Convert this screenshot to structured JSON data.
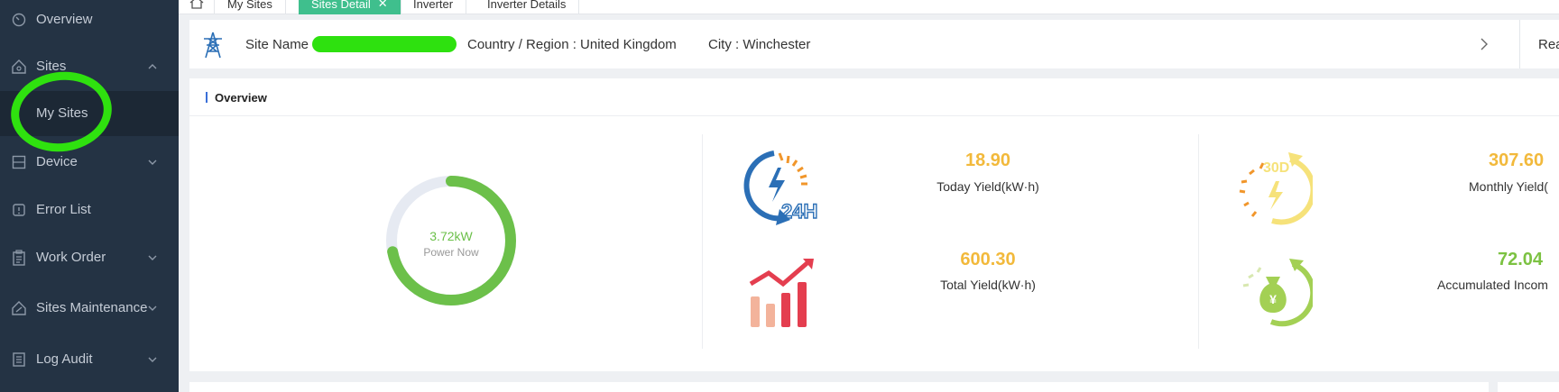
{
  "sidebar": {
    "items": [
      {
        "label": "Overview"
      },
      {
        "label": "Sites"
      },
      {
        "label": "My Sites"
      },
      {
        "label": "Device"
      },
      {
        "label": "Error List"
      },
      {
        "label": "Work Order"
      },
      {
        "label": "Sites Maintenance"
      },
      {
        "label": "Log Audit"
      }
    ]
  },
  "tabs": [
    {
      "label": "My Sites"
    },
    {
      "label": "Sites Detail"
    },
    {
      "label": "Inverter"
    },
    {
      "label": "Inverter Details"
    }
  ],
  "site": {
    "name_label": "Site Name",
    "country": "Country / Region : United Kingdom",
    "city": "City : Winchester",
    "right_label": "Rea"
  },
  "overview": {
    "title": "Overview",
    "power_now_value": "3.72kW",
    "power_now_label": "Power Now",
    "power_now_fraction": 0.72,
    "icon_24h_text": "24H",
    "icon_30d_text": "30D",
    "icon_currency": "¥",
    "stats": [
      {
        "value": "18.90",
        "label": "Today Yield(kW·h)",
        "color": "#f2b93b"
      },
      {
        "value": "307.60",
        "label": "Monthly Yield(",
        "color": "#f2b93b"
      },
      {
        "value": "600.30",
        "label": "Total Yield(kW·h)",
        "color": "#f2b93b"
      },
      {
        "value": "72.04",
        "label": "Accumulated Incom",
        "color": "#7cc242"
      }
    ]
  },
  "colors": {
    "sidebar_bg": "#243344",
    "active_tab": "#3fbf8d",
    "gauge_fill": "#6cc04a",
    "gauge_track": "#e6eaf2"
  }
}
